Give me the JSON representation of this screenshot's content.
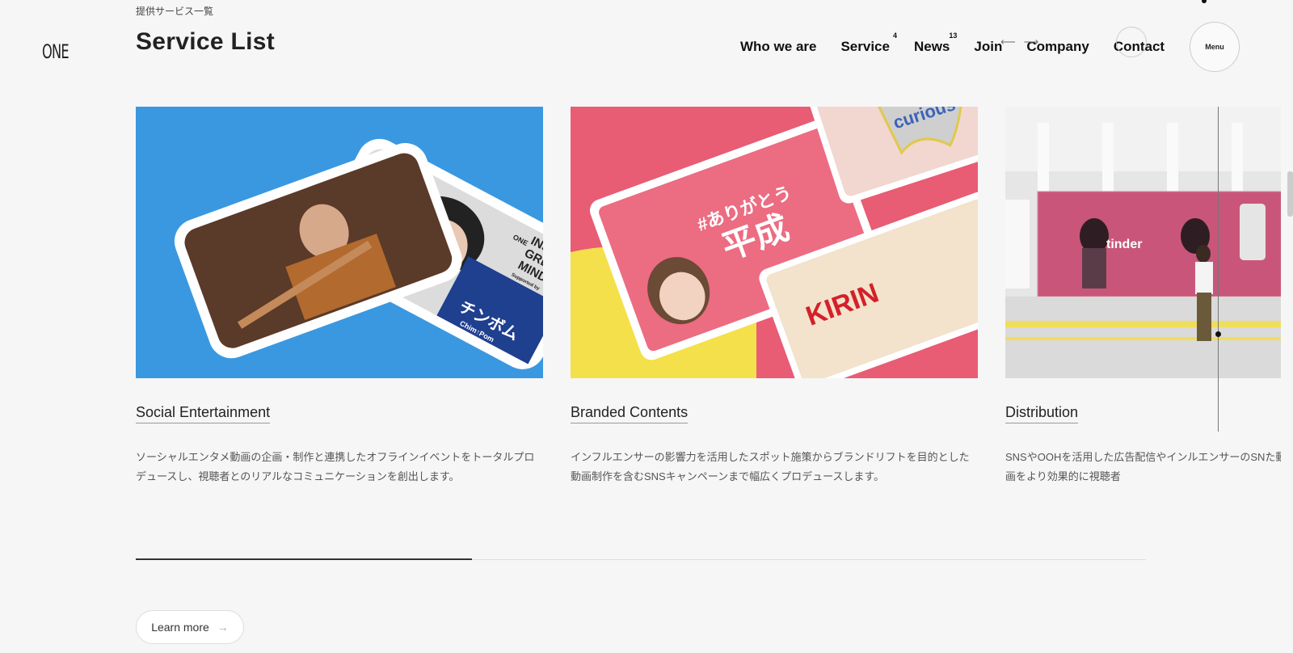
{
  "brand": {
    "logo_text": "ONE"
  },
  "section": {
    "eyebrow": "提供サービス一覧",
    "title": "Service List"
  },
  "nav": {
    "items": [
      {
        "label": "Who we are",
        "badge": ""
      },
      {
        "label": "Service",
        "badge": "4"
      },
      {
        "label": "News",
        "badge": "13"
      },
      {
        "label": "Join",
        "badge": ""
      },
      {
        "label": "Company",
        "badge": ""
      },
      {
        "label": "Contact",
        "badge": ""
      }
    ],
    "menu_label": "Menu"
  },
  "cards": [
    {
      "title": "Social Entertainment",
      "description": "ソーシャルエンタメ動画の企画・制作と連携したオフラインイベントをトータルプロデュースし、視聴者とのリアルなコミュニケーションを創出します。",
      "image_text": [
        "ONE",
        "INSIDE",
        "GREAT",
        "MINDS",
        "Supported by",
        "チンボム",
        "Chim↑Pom"
      ],
      "bg": "#3a98e0"
    },
    {
      "title": "Branded Contents",
      "description": "インフルエンサーの影響力を活用したスポット施策からブランドリフトを目的とした動画制作を含むSNSキャンペーンまで幅広くプロデュースします。",
      "image_text": [
        "#ありがとう",
        "平成",
        "curious",
        "KIRIN"
      ],
      "bg": "#e85c74"
    },
    {
      "title": "Distribution",
      "description": "SNSやOOHを活用した広告配信やインルエンサーのSNた動画配信を行い、制作した動画をより効果的に視聴者",
      "image_text": [
        "tinder"
      ],
      "bg": "#d9d9d9"
    }
  ],
  "carousel": {
    "progress": 0.333
  },
  "cta": {
    "learn_more": "Learn more"
  },
  "colors": {
    "accent_blue": "#3a98e0",
    "accent_pink": "#e85c74",
    "text": "#222222"
  }
}
